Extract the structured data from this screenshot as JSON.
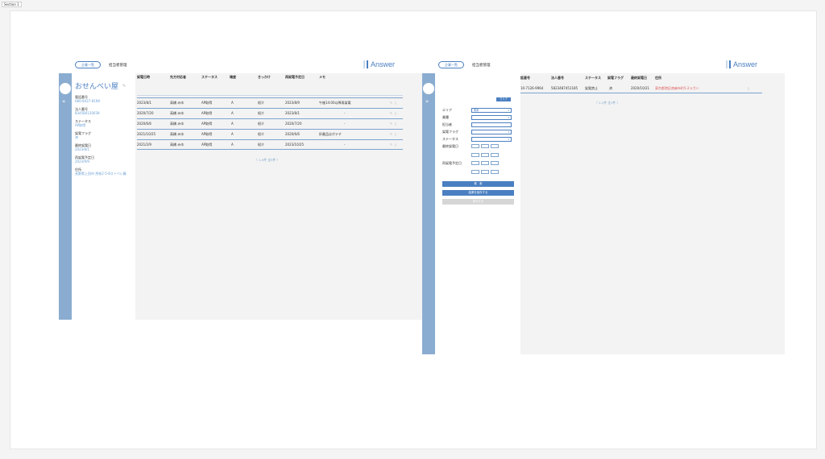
{
  "section_label": "Section 1",
  "left": {
    "topbar": {
      "back_button": "企業一覧",
      "tab_label": "担当者管理",
      "logo_text": "Answer"
    },
    "sidebar": {
      "collapse_icon": "«"
    },
    "company": {
      "name": "おせんべい屋",
      "fields": [
        {
          "label": "電話番号",
          "value": "080-8437-8198"
        },
        {
          "label": "法人番号",
          "value": "834580120039"
        },
        {
          "label": "ステータス",
          "value": "AP取得"
        },
        {
          "label": "架電フラグ",
          "value": "済"
        },
        {
          "label": "最終架電日",
          "value": "2023/8/1"
        },
        {
          "label": "再架電予定日",
          "value": "2023/9/9"
        },
        {
          "label": "住所",
          "value": "長野県上田市 然枝2-5-8ストベい藤"
        }
      ]
    },
    "table": {
      "headers": [
        "架電日時",
        "先方対応者",
        "ステータス",
        "確度",
        "きっかけ",
        "再架電予定日",
        "メモ"
      ],
      "rows": [
        [
          "2023/8/1",
          "高橋 みゆ",
          "AP取得",
          "A",
          "紹介",
          "2023/8/9",
          "午後14:00以降再架電"
        ],
        [
          "2020/7/20",
          "高橋 みゆ",
          "AP取得",
          "A",
          "紹介",
          "2023/8/1",
          "-"
        ],
        [
          "2020/6/6",
          "高橋 みゆ",
          "AP取得",
          "A",
          "紹介",
          "2020/7/20",
          "-"
        ],
        [
          "2021/10/25",
          "高橋 みゆ",
          "AP取得",
          "A",
          "紹介",
          "2020/6/6",
          "折最品はボテチ"
        ],
        [
          "2021/2/9",
          "高橋 みゆ",
          "AP取得",
          "A",
          "紹介",
          "2023/10/25",
          "-"
        ]
      ],
      "pagination": "〈  1-5件  全5件  〉"
    }
  },
  "right": {
    "topbar": {
      "back_button": "企業一覧",
      "tab_label": "担当者管理",
      "logo_text": "Answer"
    },
    "sidebar": {
      "collapse_icon": "»"
    },
    "filters": {
      "clear_button": "クリア",
      "labels": [
        "エリア",
        "業種",
        "担当者",
        "架電フラグ",
        "ステータス",
        "最終架電日",
        "再架電予定日"
      ],
      "area_value": "関東",
      "search_button": "検　索",
      "save_button": "結果を保存する",
      "disabled_button": "保存する"
    },
    "table": {
      "headers": [
        "話番号",
        "法人番号",
        "ステータス",
        "架電フラグ",
        "最終架電日",
        "住所"
      ],
      "rows": [
        [
          "10-7126-9964",
          "5823487451185",
          "架電禁止",
          "済",
          "2020/10/21",
          "東京都港区南麻布町5-2ラガハ"
        ]
      ],
      "pagination": "〈  1-1件  全1件  〉"
    }
  }
}
